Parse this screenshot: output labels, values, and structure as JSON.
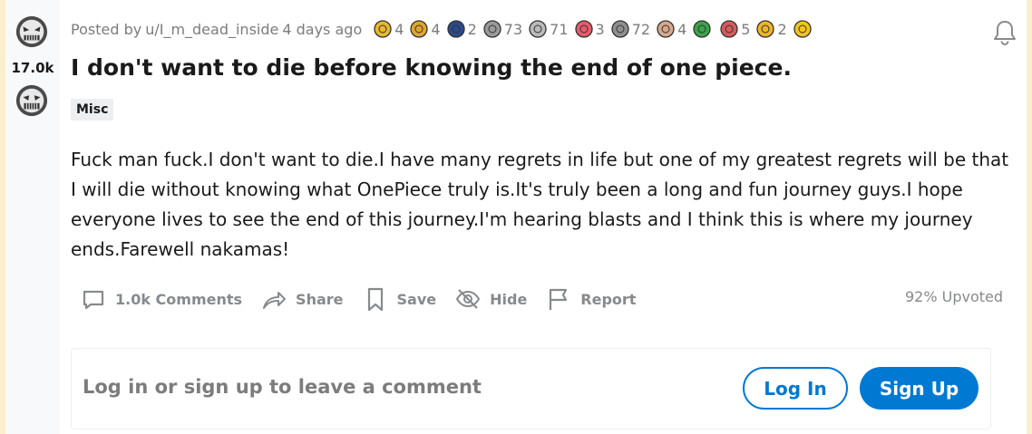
{
  "post": {
    "score": "17.0k",
    "posted_by_prefix": "Posted by",
    "author": "u/I_m_dead_inside",
    "time": "4 days ago",
    "title": "I don't want to die before knowing the end of one piece.",
    "flair": "Misc",
    "body": "Fuck man fuck.I don't want to die.I have many regrets in life but one of my greatest regrets will be that I will die without knowing what OnePiece truly is.It's truly been a long and fun journey guys.I hope everyone lives to see the end of this journey.I'm hearing blasts and I think this is where my journey ends.Farewell nakamas!",
    "awards": [
      {
        "icon": "gold-star-award-icon",
        "count": "4",
        "color": "#e8b830"
      },
      {
        "icon": "hands-award-icon",
        "count": "4",
        "color": "#e0a52c"
      },
      {
        "icon": "police-award-icon",
        "count": "2",
        "color": "#2a4a8c"
      },
      {
        "icon": "bandage-award-icon",
        "count": "73",
        "color": "#9a9a9a"
      },
      {
        "icon": "laughing-award-icon",
        "count": "71",
        "color": "#bbbbbb"
      },
      {
        "icon": "heart-face-award-icon",
        "count": "3",
        "color": "#e85a6a"
      },
      {
        "icon": "silver-coin-award-icon",
        "count": "72",
        "color": "#8f8f8f"
      },
      {
        "icon": "hug-award-icon",
        "count": "4",
        "color": "#d7a88a"
      },
      {
        "icon": "tree-award-icon",
        "count": "",
        "color": "#3ba34a"
      },
      {
        "icon": "snoo-award-icon",
        "count": "5",
        "color": "#d95a5a"
      },
      {
        "icon": "heart-eyes-award-icon",
        "count": "2",
        "color": "#f0b429"
      },
      {
        "icon": "up-arrow-award-icon",
        "count": "",
        "color": "#f5c518"
      }
    ]
  },
  "actions": {
    "comments": "1.0k Comments",
    "share": "Share",
    "save": "Save",
    "hide": "Hide",
    "report": "Report",
    "upvoted": "92% Upvoted"
  },
  "comment_box": {
    "prompt": "Log in or sign up to leave a comment",
    "login": "Log In",
    "signup": "Sign Up"
  },
  "colors": {
    "brand_blue": "#0079d3",
    "page_background": "#fbeecd"
  }
}
